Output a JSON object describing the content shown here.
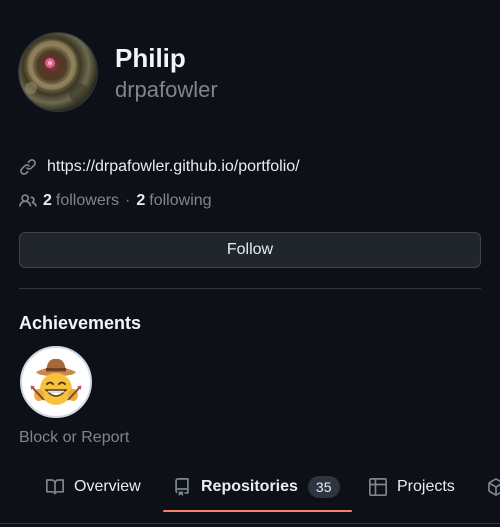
{
  "profile": {
    "name": "Philip",
    "login": "drpafowler",
    "website": "https://drpafowler.github.io/portfolio/",
    "followers_count": "2",
    "followers_label": "followers",
    "separator": "·",
    "following_count": "2",
    "following_label": "following"
  },
  "actions": {
    "follow_label": "Follow",
    "block_report_label": "Block or Report"
  },
  "achievements": {
    "title": "Achievements",
    "badges": [
      {
        "icon": "cowboy-grin-face-icon"
      }
    ]
  },
  "tabs": {
    "overview": {
      "label": "Overview",
      "icon": "book-icon"
    },
    "repositories": {
      "label": "Repositories",
      "icon": "repo-icon",
      "count": "35",
      "selected": true
    },
    "projects": {
      "label": "Projects",
      "icon": "table-icon"
    },
    "packages": {
      "icon": "package-icon"
    }
  },
  "colors": {
    "background": "#0d1117",
    "text": "#e6edf3",
    "muted": "#7d8590",
    "button_bg": "#21262d",
    "border": "#30363d",
    "tab_underline": "#f78166"
  }
}
